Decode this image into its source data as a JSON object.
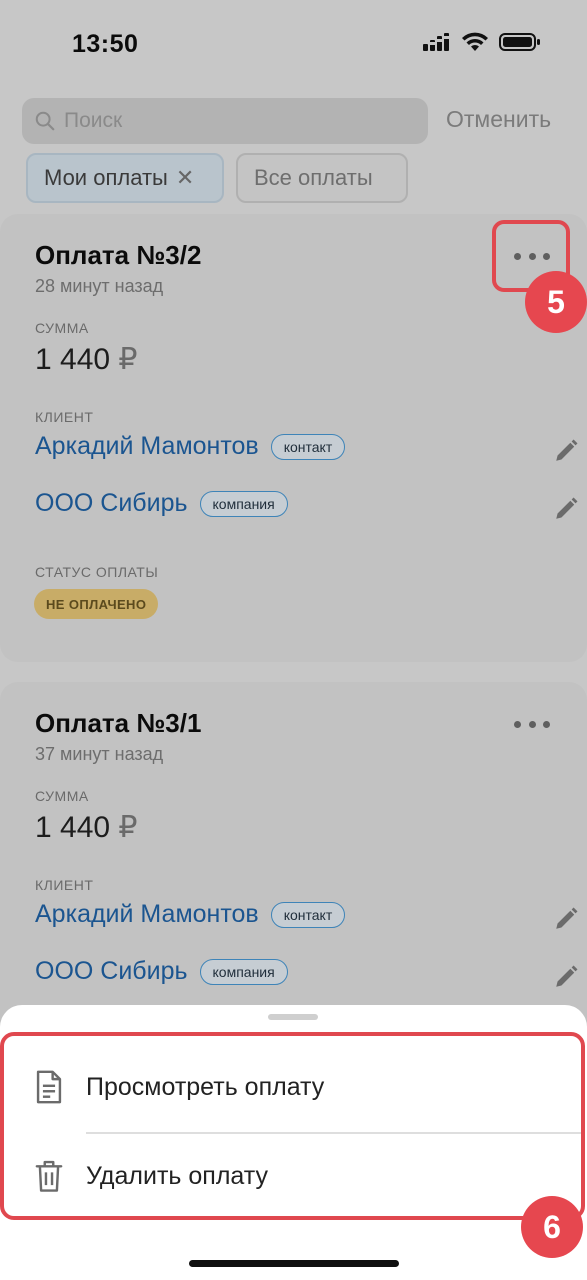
{
  "status_bar": {
    "time": "13:50"
  },
  "search": {
    "placeholder": "Поиск",
    "cancel_label": "Отменить"
  },
  "filters": [
    {
      "label": "Мои оплаты",
      "active": true
    },
    {
      "label": "Все оплаты",
      "active": false
    }
  ],
  "payments": [
    {
      "title": "Оплата №3/2",
      "time_ago": "28 минут назад",
      "amount_label": "СУММА",
      "amount": "1 440",
      "currency": "₽",
      "client_label": "КЛИЕНТ",
      "clients": [
        {
          "name": "Аркадий Мамонтов",
          "tag": "контакт"
        },
        {
          "name": "ООО Сибирь",
          "tag": "компания"
        }
      ],
      "status_label": "СТАТУС ОПЛАТЫ",
      "status": "НЕ ОПЛАЧЕНО"
    },
    {
      "title": "Оплата №3/1",
      "time_ago": "37 минут назад",
      "amount_label": "СУММА",
      "amount": "1 440",
      "currency": "₽",
      "client_label": "КЛИЕНТ",
      "clients": [
        {
          "name": "Аркадий Мамонтов",
          "tag": "контакт"
        },
        {
          "name": "ООО Сибирь",
          "tag": "компания"
        }
      ]
    }
  ],
  "annotations": {
    "step_more": "5",
    "step_menu": "6"
  },
  "action_sheet": {
    "items": [
      {
        "label": "Просмотреть оплату",
        "icon": "document-icon"
      },
      {
        "label": "Удалить оплату",
        "icon": "trash-icon"
      }
    ]
  },
  "colors": {
    "accent_link": "#1b5590",
    "highlight": "#e0484f",
    "status_unpaid": "#c8ac67"
  }
}
